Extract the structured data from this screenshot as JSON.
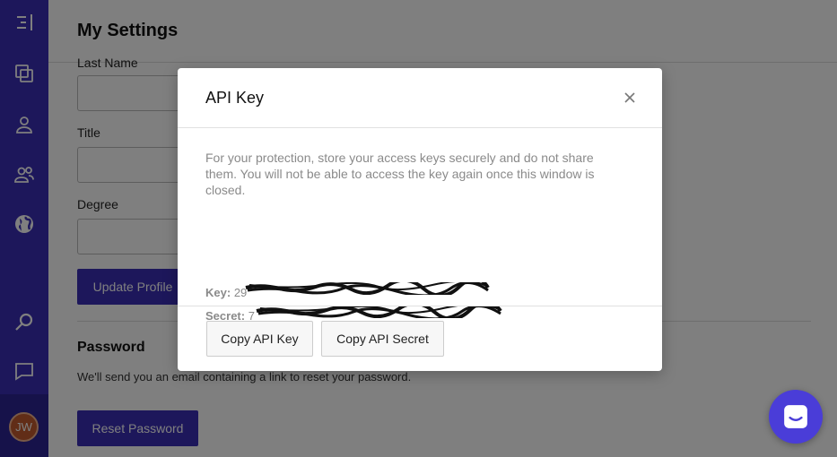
{
  "sidebar": {
    "icons": [
      "menu-collapse-icon",
      "pages-icon",
      "user-icon",
      "users-icon",
      "globe-icon",
      "search-icon",
      "chat-icon"
    ],
    "avatar_initials": "JW"
  },
  "page": {
    "title": "My Settings",
    "fields": [
      {
        "label": "Last Name",
        "value": ""
      },
      {
        "label": "Title",
        "value": ""
      },
      {
        "label": "Degree",
        "value": ""
      }
    ],
    "update_profile_label": "Update Profile",
    "password_section": {
      "title": "Password",
      "description": "We'll send you an email containing a link to reset your password.",
      "reset_label": "Reset Password"
    }
  },
  "modal": {
    "title": "API Key",
    "description": "For your protection, store your access keys securely and do not share them. You will not be able to access the key again once this window is closed.",
    "key_label": "Key:",
    "key_value": "29",
    "secret_label": "Secret:",
    "secret_value": "7",
    "copy_key_label": "Copy API Key",
    "copy_secret_label": "Copy API Secret"
  },
  "colors": {
    "brand": "#3b2fb7",
    "chat_launcher": "#4a3dd8",
    "avatar": "#c25a2e"
  }
}
